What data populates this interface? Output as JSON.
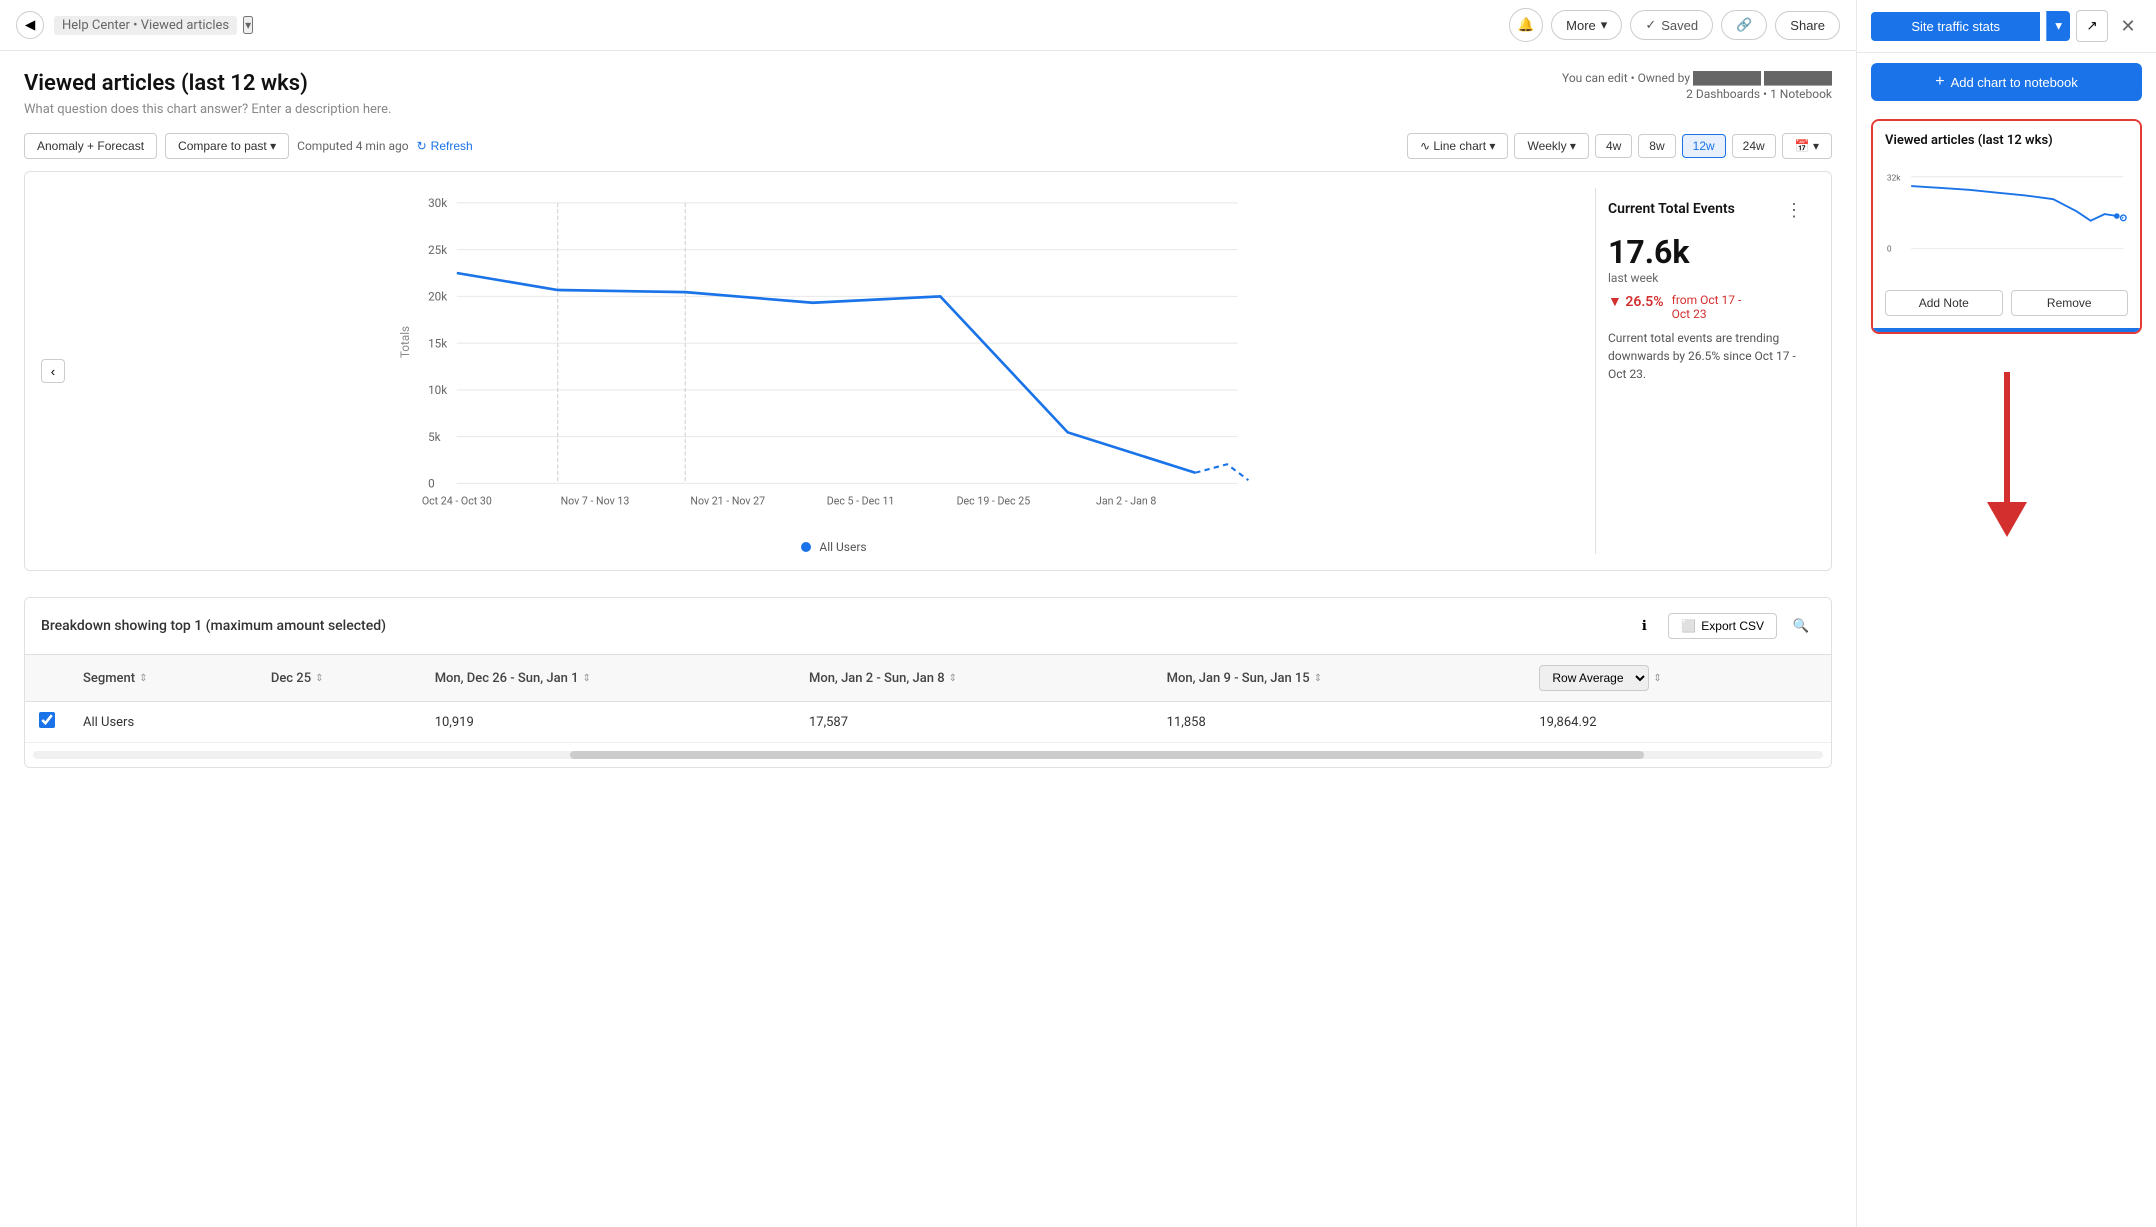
{
  "nav": {
    "back_icon": "◀",
    "breadcrumb_text": "Help Center • Viewed articles",
    "chevron": "▾",
    "bell_icon": "🔔",
    "more_label": "More",
    "saved_icon": "✓",
    "saved_label": "Saved",
    "link_icon": "🔗",
    "share_label": "Share"
  },
  "chart_header": {
    "title": "Viewed articles (last 12 wks)",
    "description": "What question does this chart answer? Enter a description here.",
    "meta1": "You can edit • Owned by ████████ ████████",
    "meta2": "2 Dashboards • 1 Notebook"
  },
  "toolbar": {
    "anomaly_label": "Anomaly + Forecast",
    "compare_label": "Compare to past",
    "computed_label": "Computed 4 min ago",
    "refresh_label": "Refresh",
    "line_chart_label": "Line chart",
    "weekly_label": "Weekly",
    "time_4w": "4w",
    "time_8w": "8w",
    "time_12w": "12w",
    "time_24w": "24w",
    "calendar_icon": "📅"
  },
  "chart": {
    "y_labels": [
      "30k",
      "25k",
      "20k",
      "15k",
      "10k",
      "5k",
      "0"
    ],
    "x_labels": [
      "Oct 24 - Oct 30",
      "Nov 7 - Nov 13",
      "Nov 21 - Nov 27",
      "Dec 5 - Dec 11",
      "Dec 19 - Dec 25",
      "Jan 2 - Jan 8"
    ],
    "y_axis_label": "Totals",
    "legend_label": "All Users",
    "nav_left_icon": "‹"
  },
  "insight": {
    "title": "Current Total Events",
    "menu_icon": "⋮",
    "value": "17.6k",
    "label": "last week",
    "change_pct": "▼ 26.5%",
    "change_from": "from Oct 17 -",
    "change_to": "Oct 23",
    "trend_text": "Current total events are trending downwards by 26.5% since Oct 17 - Oct 23."
  },
  "breakdown": {
    "title": "Breakdown showing top 1 (maximum amount selected)",
    "info_icon": "ℹ",
    "export_icon": "⬜",
    "export_label": "Export CSV",
    "search_icon": "🔍",
    "columns": [
      "Segment",
      "Dec 25",
      "Mon, Dec 26 - Sun, Jan 1",
      "Mon, Jan 2 - Sun, Jan 8",
      "Mon, Jan 9 - Sun, Jan 15",
      "Row Average"
    ],
    "rows": [
      {
        "checked": true,
        "segment": "All Users",
        "dec25": "",
        "dec26_jan1": "10,919",
        "jan2_jan8": "17,587",
        "jan9_jan15": "11,858",
        "row_avg": "19,864.92"
      }
    ]
  },
  "right_panel": {
    "site_stats_label": "Site traffic stats",
    "chevron_icon": "▾",
    "external_icon": "⬡",
    "close_icon": "✕",
    "add_chart_icon": "+",
    "add_chart_label": "Add chart to notebook",
    "preview_title": "Viewed articles (last 12 wks)",
    "preview_y1": "32k",
    "preview_y2": "0",
    "add_note_label": "Add Note",
    "remove_label": "Remove"
  },
  "colors": {
    "blue": "#1a73e8",
    "red": "#d32f2f",
    "red_border": "#e53935",
    "light_blue": "#e8f0fe",
    "line_color": "#1a73e8"
  }
}
